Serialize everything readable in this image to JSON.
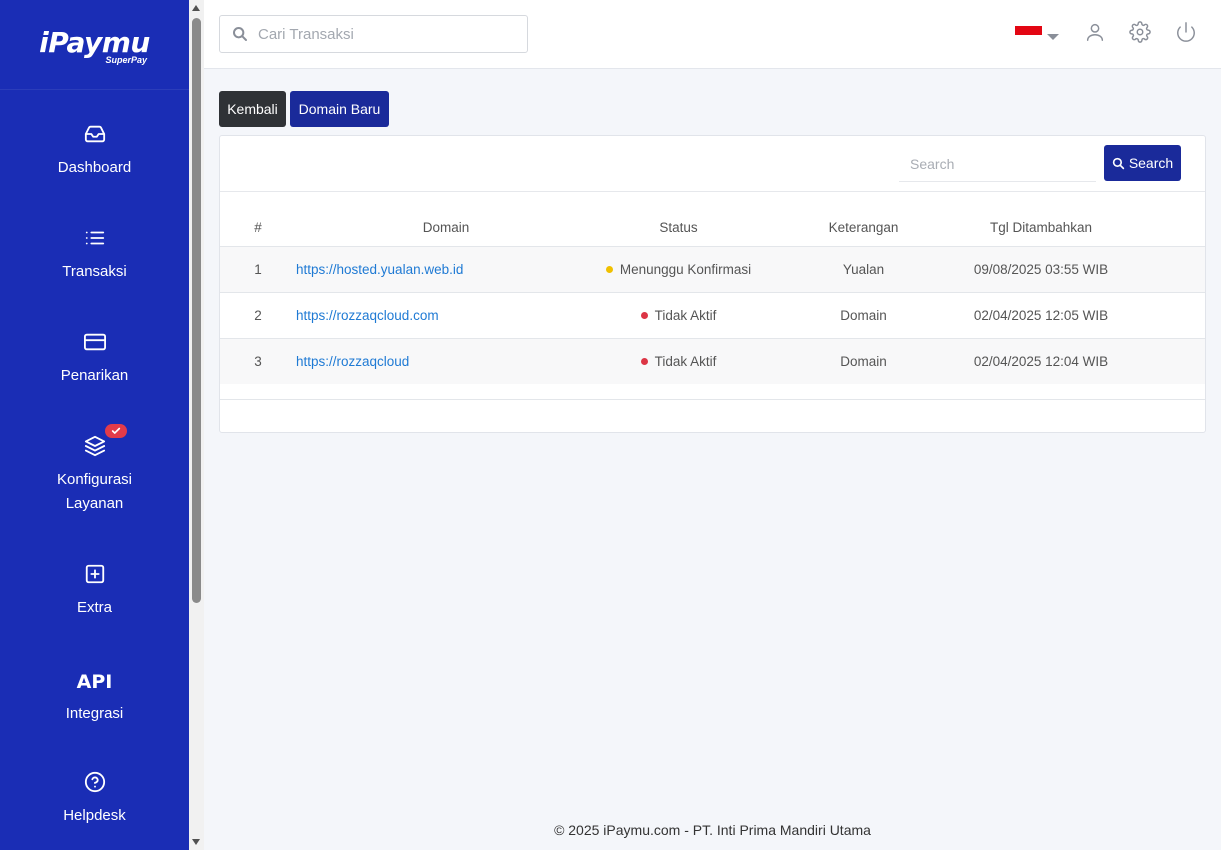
{
  "brand": {
    "name": "iPaymu",
    "sub": "SuperPay"
  },
  "sidebar": {
    "items": [
      {
        "label": "Dashboard",
        "icon": "inbox-icon"
      },
      {
        "label": "Transaksi",
        "icon": "list-icon"
      },
      {
        "label": "Penarikan",
        "icon": "credit-card-icon"
      },
      {
        "label": "Konfigurasi\nLayanan",
        "label_line1": "Konfigurasi",
        "label_line2": "Layanan",
        "icon": "layers-icon",
        "badge": "check-icon"
      },
      {
        "label": "Extra",
        "icon": "plus-square-icon"
      },
      {
        "label": "Integrasi",
        "icon_text": "API"
      },
      {
        "label": "Helpdesk",
        "icon": "help-circle-icon"
      }
    ]
  },
  "header": {
    "search_placeholder": "Cari Transaksi",
    "flag": "indonesia-flag",
    "icons": [
      "user-icon",
      "gear-icon",
      "power-icon"
    ]
  },
  "actions": {
    "back_label": "Kembali",
    "new_label": "Domain Baru"
  },
  "table_search": {
    "placeholder": "Search",
    "button_label": "Search"
  },
  "table": {
    "headers": [
      "#",
      "Domain",
      "Status",
      "Keterangan",
      "Tgl Ditambahkan"
    ],
    "rows": [
      {
        "no": "1",
        "domain": "https://hosted.yualan.web.id",
        "status": "Menunggu Konfirmasi",
        "status_color": "#f0c000",
        "keterangan": "Yualan",
        "tgl": "09/08/2025 03:55 WIB"
      },
      {
        "no": "2",
        "domain": "https://rozzaqcloud.com",
        "status": "Tidak Aktif",
        "status_color": "#dc3545",
        "keterangan": "Domain",
        "tgl": "02/04/2025 12:05 WIB"
      },
      {
        "no": "3",
        "domain": "https://rozzaqcloud",
        "status": "Tidak Aktif",
        "status_color": "#dc3545",
        "keterangan": "Domain",
        "tgl": "02/04/2025 12:04 WIB"
      }
    ]
  },
  "footer": {
    "text": "© 2025 iPaymu.com - PT. Inti Prima Mandiri Utama"
  },
  "colors": {
    "sidebar": "#1a2db5",
    "primary_button": "#1a2a9a",
    "dark_button": "#2f3236",
    "link": "#1f7ad4"
  }
}
